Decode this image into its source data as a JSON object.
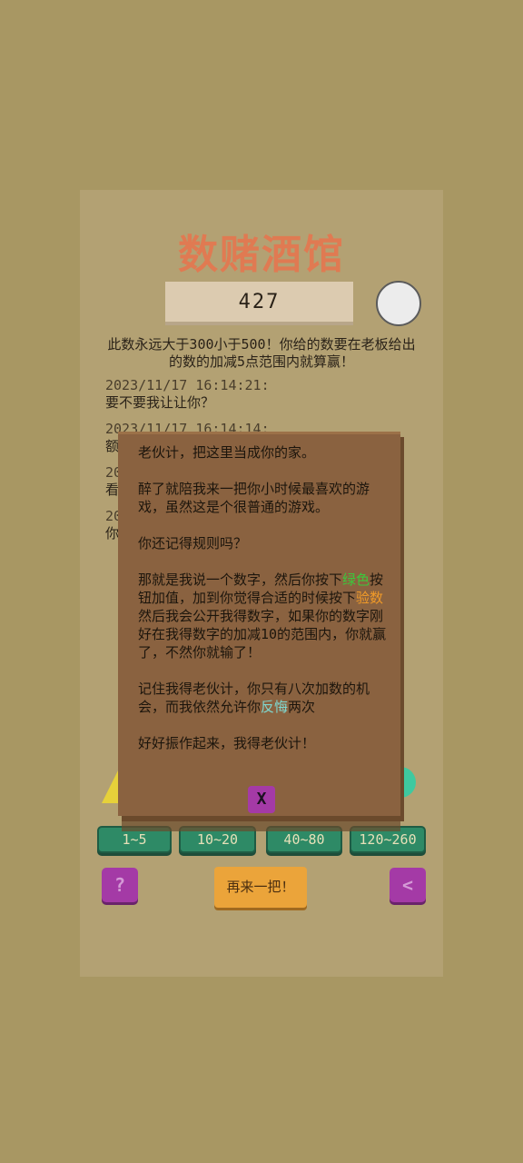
{
  "title": "数赌酒馆",
  "number_display": "427",
  "hint": "此数永远大于300小于500！你给的数要在老板给出的数的加减5点范围内就算赢！",
  "log": [
    {
      "time": "2023/11/17 16:14:21:",
      "text": "要不要我让让你？"
    },
    {
      "time": "2023/11/17 16:14:14:",
      "text": "额"
    },
    {
      "time": "20",
      "text": "看"
    },
    {
      "time": "20",
      "text": "你"
    }
  ],
  "chips": [
    "1~5",
    "10~20",
    "40~80",
    "120~260"
  ],
  "help_label": "?",
  "retry_label": "再来一把！",
  "back_label": "<",
  "modal": {
    "p1": "老伙计，把这里当成你的家。",
    "p2": "醉了就陪我来一把你小时候最喜欢的游戏，虽然这是个很普通的游戏。",
    "p3": "你还记得规则吗？",
    "p4a": "那就是我说一个数字，然后你按下",
    "p4_green": "绿色",
    "p4b": "按钮加值，加到你觉得合适的时候按下",
    "p4_orange": "验数",
    "p4c": "然后我会公开我得数字，如果你的数字刚好在我得数字的加减10的范围内，你就赢了，不然你就输了！",
    "p5a": "记住我得老伙计，你只有八次加数的机会，而我依然允许你",
    "p5_teal": "反悔",
    "p5b": "两次",
    "p6": "好好振作起来，我得老伙计！",
    "close_label": "X"
  },
  "colors": {
    "background": "#a89763",
    "panel": "#b3a173",
    "title": "#e07a52",
    "modal": "#8a6240",
    "chip": "#2e8a66",
    "purple_button": "#a43aa6",
    "orange_button": "#eba43a"
  }
}
